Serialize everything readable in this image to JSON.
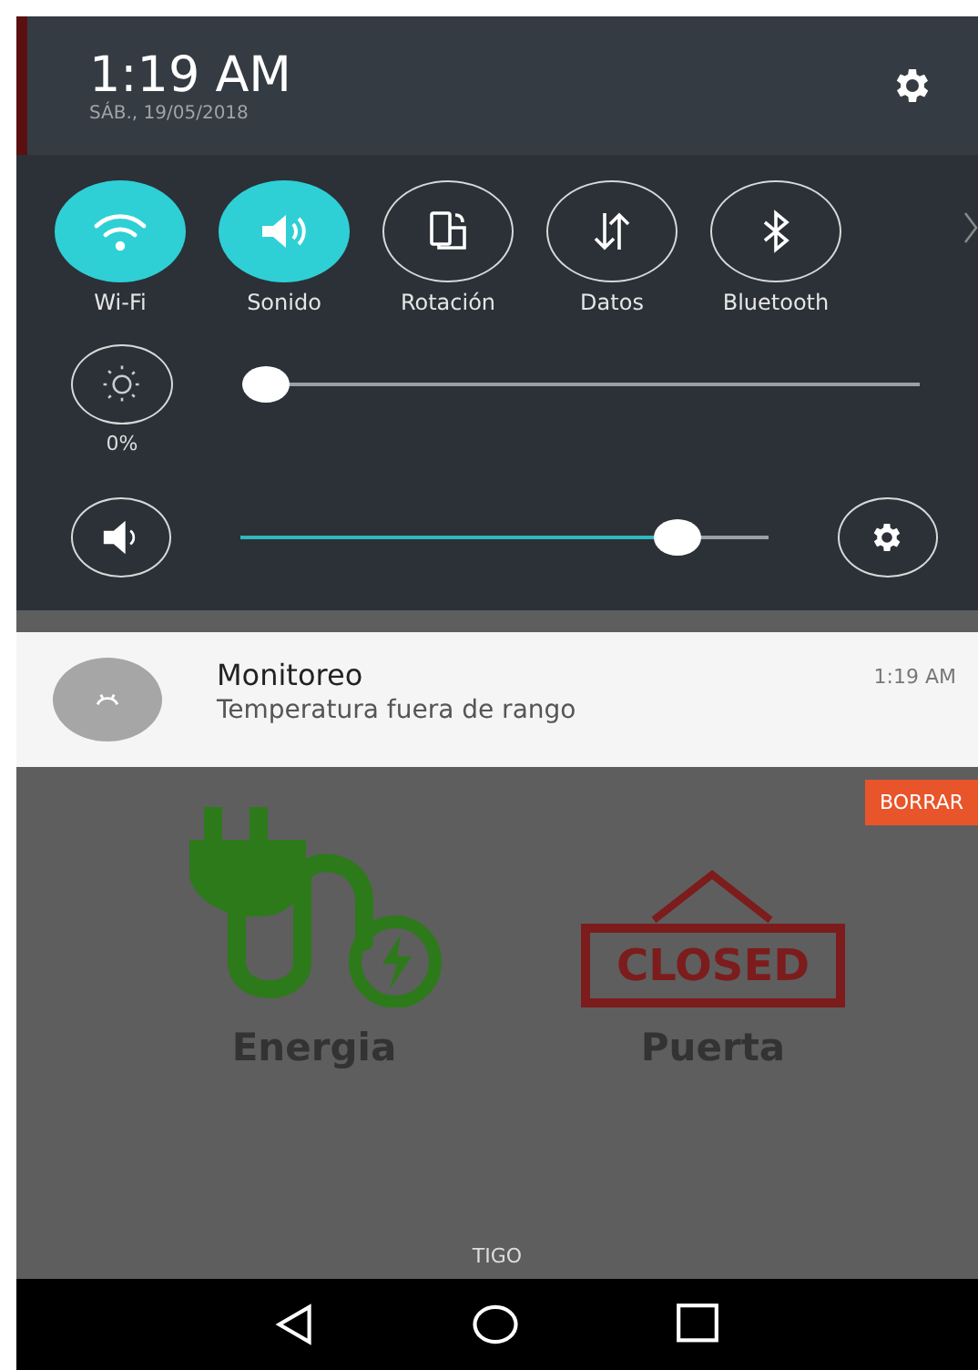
{
  "status": {
    "time": "1:19 AM",
    "date": "SÁB., 19/05/2018"
  },
  "toggles": [
    {
      "kind": "wifi",
      "label": "Wi-Fi",
      "on": true
    },
    {
      "kind": "sound",
      "label": "Sonido",
      "on": true
    },
    {
      "kind": "rotation",
      "label": "Rotación",
      "on": false
    },
    {
      "kind": "data",
      "label": "Datos",
      "on": false
    },
    {
      "kind": "bluetooth",
      "label": "Bluetooth",
      "on": false
    }
  ],
  "brightness": {
    "level": 0.0,
    "reading": "0%"
  },
  "volume": {
    "level": 0.86
  },
  "notification": {
    "title": "Monitoreo",
    "text": "Temperatura fuera de rango",
    "time": "1:19 AM"
  },
  "clear_button": "BORRAR",
  "app_tiles": [
    {
      "kind": "energy",
      "label": "Energia"
    },
    {
      "kind": "door",
      "label": "Puerta",
      "sign_text": "CLOSED"
    }
  ],
  "carrier": "TIGO"
}
